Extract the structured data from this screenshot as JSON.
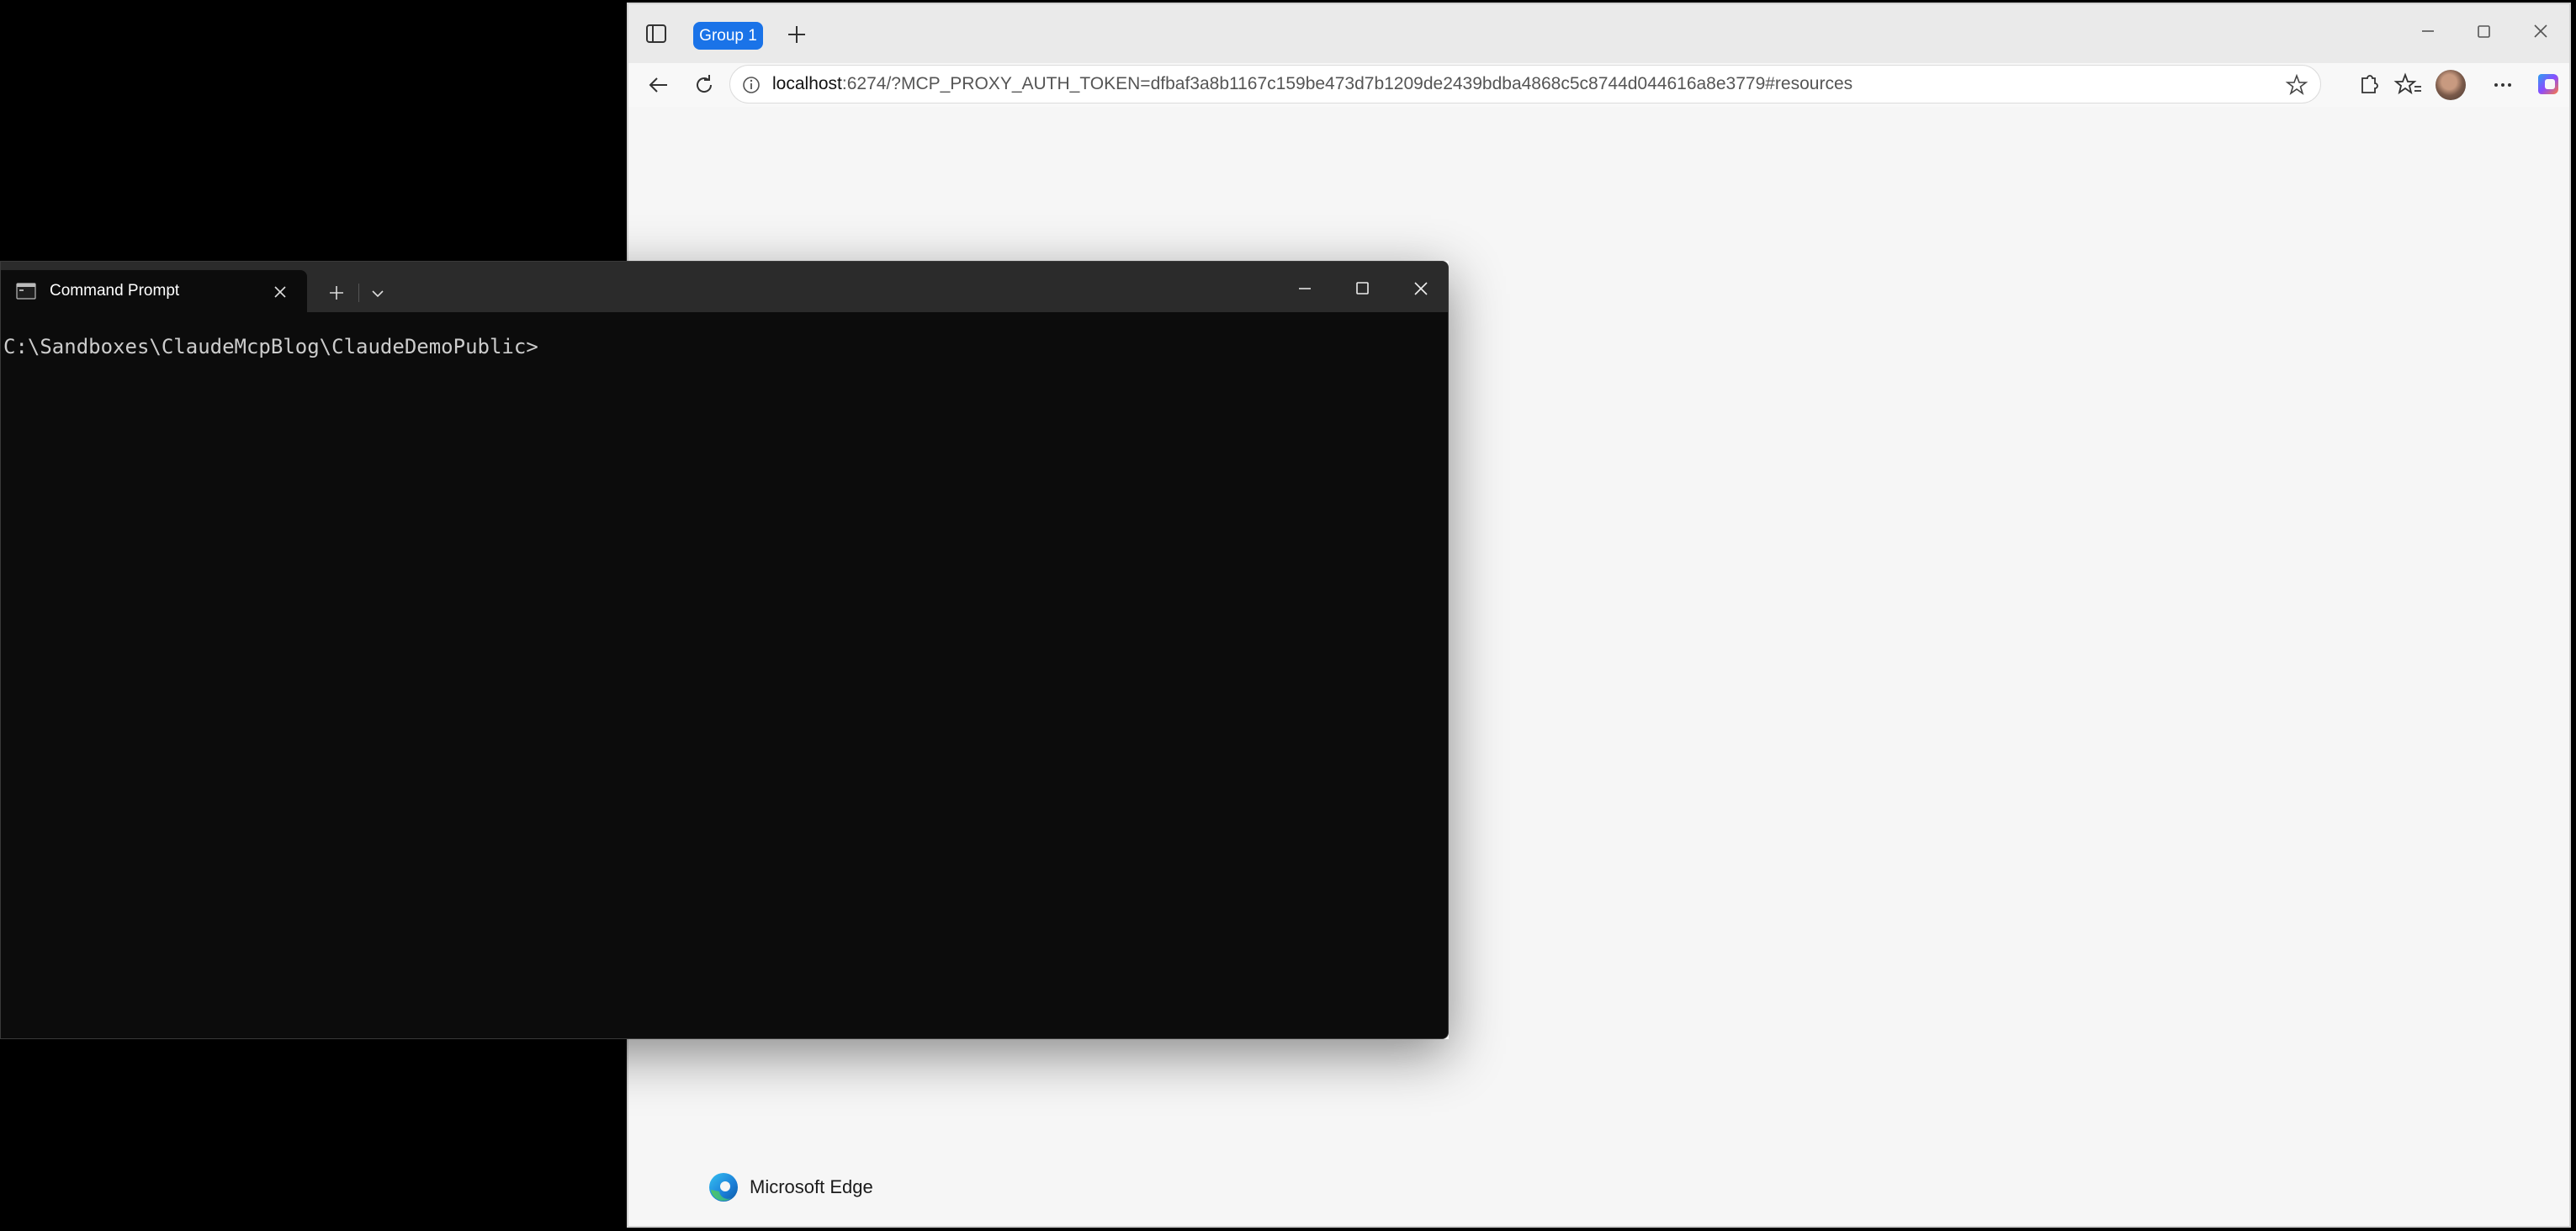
{
  "browser": {
    "tab_group_label": "Group 1",
    "address": {
      "host": "localhost",
      "rest": ":6274/?MCP_PROXY_AUTH_TOKEN=dfbaf3a8b1167c159be473d7b1209de2439bdba4868c5c8744d044616a8e3779#resources"
    },
    "footer_brand": "Microsoft Edge",
    "icons": [
      "tab-actions-icon",
      "plus-icon",
      "minimize-icon",
      "maximize-icon",
      "close-icon",
      "back-arrow-icon",
      "refresh-icon",
      "info-icon",
      "star-icon",
      "extensions-icon",
      "favorites-icon",
      "avatar",
      "more-icon",
      "copilot-icon",
      "edge-logo-icon"
    ],
    "colors": {
      "tab_group": "#1a73e8",
      "page_background": "#f6f6f6"
    }
  },
  "terminal": {
    "tab_label": "Command Prompt",
    "prompt": "C:\\Sandboxes\\ClaudeMcpBlog\\ClaudeDemoPublic>",
    "icons": [
      "cmd-icon",
      "close-icon",
      "plus-icon",
      "chevron-down-icon",
      "minimize-icon",
      "maximize-icon",
      "close-icon"
    ],
    "colors": {
      "background": "#0c0c0c",
      "text": "#cccccc"
    }
  }
}
